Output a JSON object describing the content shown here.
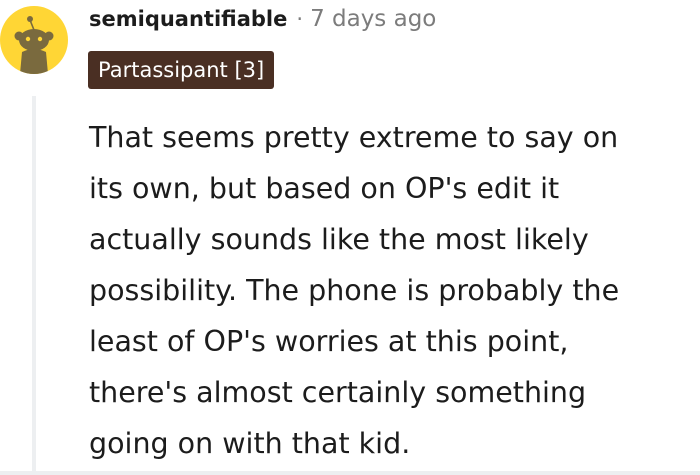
{
  "comment": {
    "author": "semiquantifiable",
    "separator": "·",
    "timestamp": "7 days ago",
    "flair": "Partassipant [3]",
    "body_lines": [
      "That seems pretty extreme to say on",
      "its own, but based on OP's edit it",
      "actually sounds like the most likely",
      "possibility. The phone is probably the",
      "least of OP's worries at this point,",
      "there's almost certainly something",
      "going on with that kid."
    ]
  },
  "avatar": {
    "icon": "snoo-avatar-icon",
    "background_color": "#ffd635"
  },
  "colors": {
    "text": "#1c1c1c",
    "meta": "#7c7c7c",
    "flair_background": "#4a2f23",
    "flair_text": "#ffffff",
    "thread_line": "#edeff1"
  }
}
